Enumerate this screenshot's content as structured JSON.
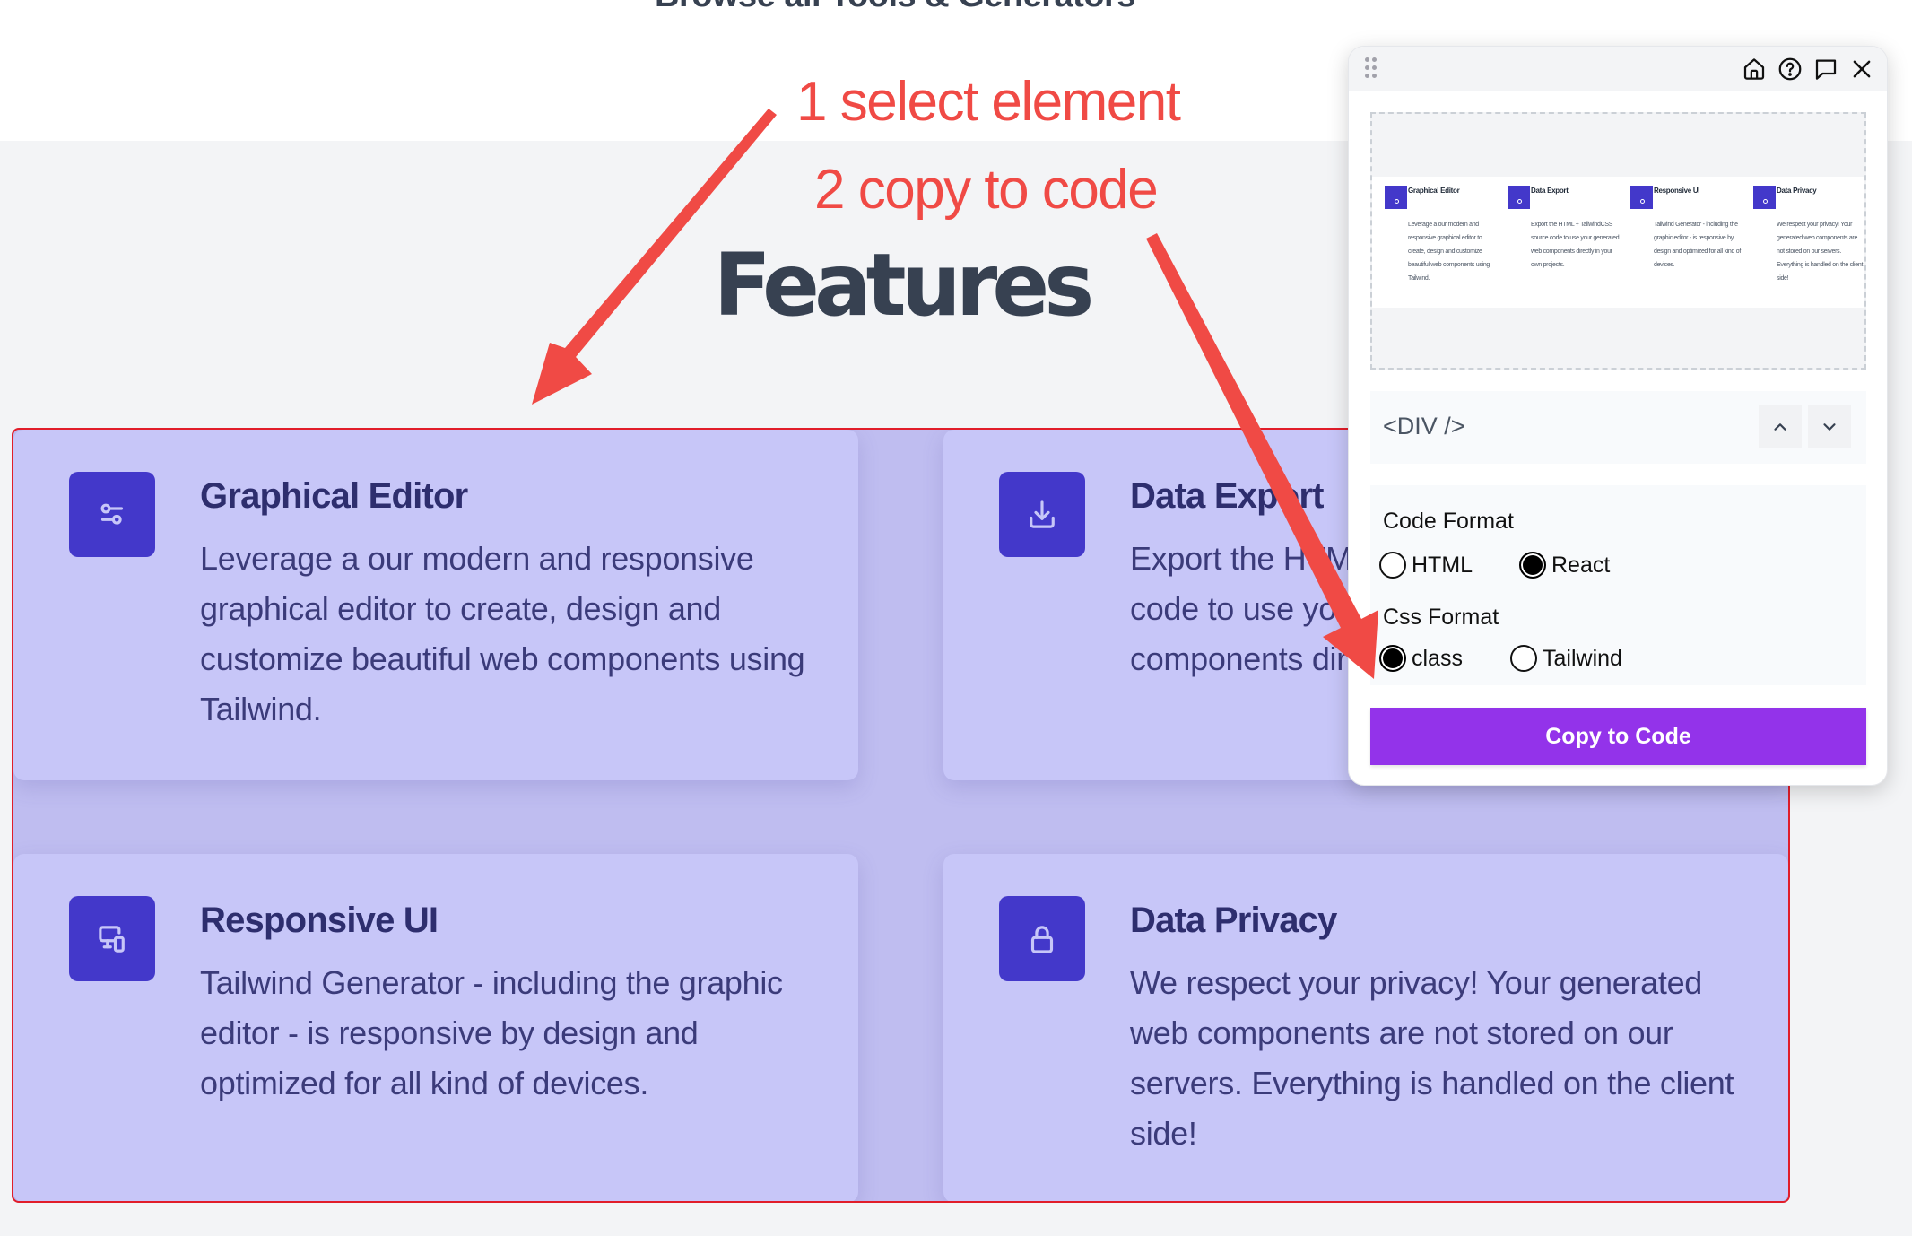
{
  "page": {
    "browse_title": "Browse all Tools & Generators",
    "section_title": "Features"
  },
  "annotations": {
    "step1": "1 select element",
    "step2": "2 copy to code",
    "color": "#F04A45"
  },
  "features": [
    {
      "icon": "sliders-icon",
      "title": "Graphical Editor",
      "description": "Leverage a our modern and responsive graphical editor to create, design and customize beautiful web components using Tailwind."
    },
    {
      "icon": "download-icon",
      "title": "Data Export",
      "description": "Export the HTML + TailwindCSS source code to use your generated web components directly in your own projects."
    },
    {
      "icon": "devices-icon",
      "title": "Responsive UI",
      "description": "Tailwind Generator - including the graphic editor - is responsive by design and optimized for all kind of devices."
    },
    {
      "icon": "lock-icon",
      "title": "Data Privacy",
      "description": "We respect your privacy! Your generated web components are not stored on our servers. Everything is handled on the client side!"
    }
  ],
  "panel": {
    "header_icons": [
      "drag-handle-icon",
      "home-icon",
      "help-icon",
      "chat-icon",
      "close-icon"
    ],
    "selected_element": "<DIV />",
    "code_format": {
      "label": "Code Format",
      "options": [
        "HTML",
        "React"
      ],
      "selected": "React"
    },
    "css_format": {
      "label": "Css Format",
      "options": [
        "class",
        "Tailwind"
      ],
      "selected": "class"
    },
    "copy_button": "Copy to Code"
  },
  "colors": {
    "accent_icon_bg": "#4338CA",
    "card_bg": "#C7C6F8",
    "selection_outline": "#E11D2A",
    "copy_button_bg": "#9333EA"
  }
}
